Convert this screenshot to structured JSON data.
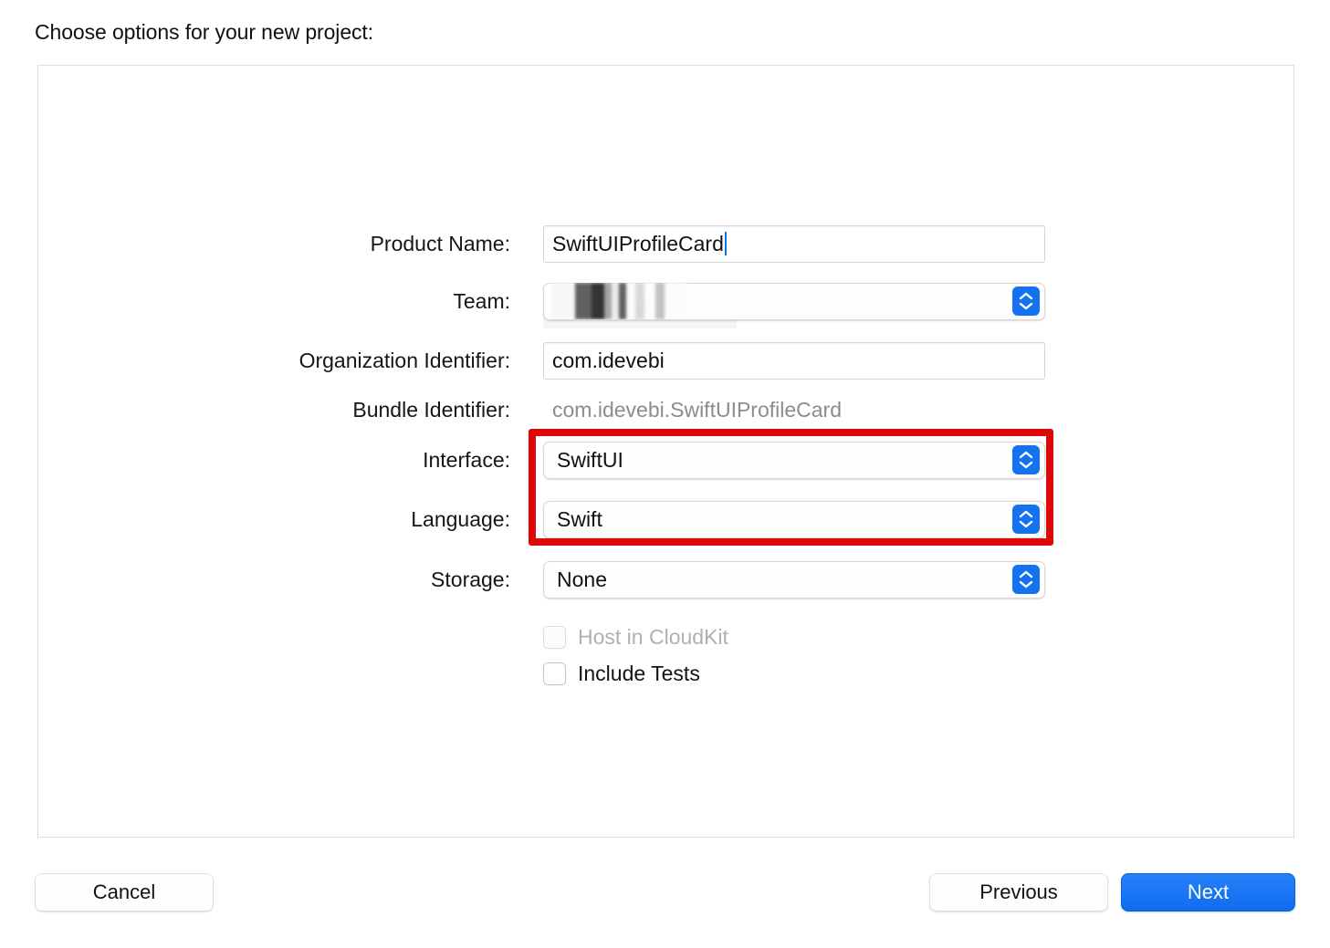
{
  "dialog": {
    "title": "Choose options for your new project:"
  },
  "form": {
    "fields": [
      {
        "label": "Product Name:",
        "type": "text",
        "value": "SwiftUIProfileCard",
        "name": "product-name"
      },
      {
        "label": "Team:",
        "type": "popup",
        "value": "",
        "redacted": true,
        "name": "team"
      },
      {
        "label": "Organization Identifier:",
        "type": "text",
        "value": "com.idevebi",
        "name": "organization-identifier"
      },
      {
        "label": "Bundle Identifier:",
        "type": "readonly",
        "value": "com.idevebi.SwiftUIProfileCard",
        "name": "bundle-identifier"
      },
      {
        "label": "Interface:",
        "type": "popup",
        "value": "SwiftUI",
        "name": "interface"
      },
      {
        "label": "Language:",
        "type": "popup",
        "value": "Swift",
        "name": "language"
      },
      {
        "label": "Storage:",
        "type": "popup",
        "value": "None",
        "name": "storage"
      }
    ],
    "checkboxes": [
      {
        "label": "Host in CloudKit",
        "checked": false,
        "disabled": true,
        "name": "host-in-cloudkit"
      },
      {
        "label": "Include Tests",
        "checked": false,
        "disabled": false,
        "name": "include-tests"
      }
    ]
  },
  "footer": {
    "cancel_label": "Cancel",
    "previous_label": "Previous",
    "next_label": "Next"
  },
  "annotation": {
    "highlight_color": "#dd0808",
    "highlighted_fields": [
      "Interface:",
      "Language:"
    ]
  },
  "colors": {
    "accent_blue": "#1272f0",
    "primary_button": "#0f6cf0",
    "caret": "#0a72f5",
    "panel_border": "#dcdcdc",
    "readonly_text": "#8c8c8c",
    "disabled_text": "#b0b0b0"
  }
}
